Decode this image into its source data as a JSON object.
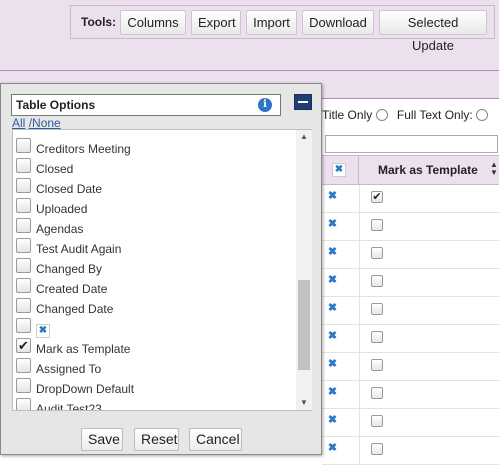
{
  "toolbar": {
    "label": "Tools:",
    "buttons": [
      "Columns",
      "Export",
      "Import",
      "Download",
      "Selected Update"
    ]
  },
  "search": {
    "title_only": "Title Only",
    "full_text_only": "Full Text Only:"
  },
  "grid": {
    "column_header": "Mark as Template",
    "rows": [
      {
        "checked": true
      },
      {
        "checked": false
      },
      {
        "checked": false
      },
      {
        "checked": false
      },
      {
        "checked": false
      },
      {
        "checked": false
      },
      {
        "checked": false
      },
      {
        "checked": false
      },
      {
        "checked": false
      },
      {
        "checked": false
      }
    ]
  },
  "popup": {
    "title": "Table Options",
    "all_label": "All",
    "none_label": "/None",
    "options": [
      {
        "label": "Creditors Meeting",
        "checked": false
      },
      {
        "label": "Closed",
        "checked": false
      },
      {
        "label": "Closed Date",
        "checked": false
      },
      {
        "label": "Uploaded",
        "checked": false
      },
      {
        "label": "Agendas",
        "checked": false
      },
      {
        "label": "Test Audit Again",
        "checked": false
      },
      {
        "label": "Changed By",
        "checked": false
      },
      {
        "label": "Created Date",
        "checked": false
      },
      {
        "label": "Changed Date",
        "checked": false
      },
      {
        "label": "",
        "checked": false,
        "icon": "delete-x-icon"
      },
      {
        "label": "Mark as Template",
        "checked": true
      },
      {
        "label": "Assigned To",
        "checked": false
      },
      {
        "label": "DropDown Default",
        "checked": false
      },
      {
        "label": "Audit Test23",
        "checked": false
      }
    ],
    "save_label": "Save",
    "reset_label": "Reset",
    "cancel_label": "Cancel"
  }
}
